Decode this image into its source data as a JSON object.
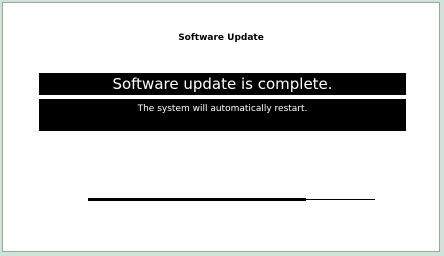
{
  "dialog": {
    "title": "Software Update",
    "status_main": "Software update is complete.",
    "status_sub": "The system will automatically restart."
  },
  "progress": {
    "fraction": 0.76
  },
  "colors": {
    "background": "#cfe3d6",
    "window": "#ffffff",
    "banner": "#000000",
    "banner_text": "#ffffff"
  }
}
